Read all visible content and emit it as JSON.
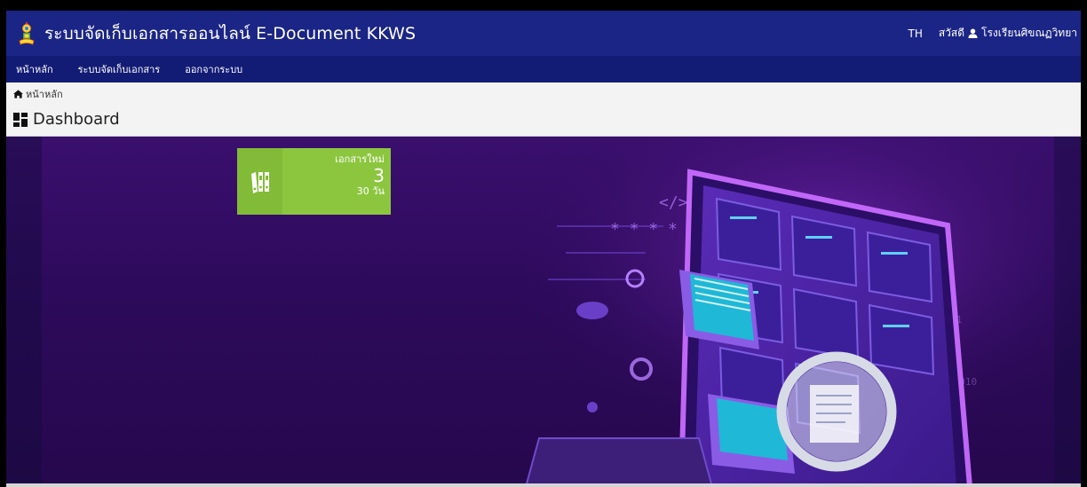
{
  "header": {
    "title": "ระบบจัดเก็บเอกสารออนไลน์ E-Document KKWS",
    "lang": "TH",
    "greeting": "สวัสดี",
    "user": "โรงเรียนศิขณฏวิทยา"
  },
  "nav": {
    "items": [
      {
        "label": "หน้าหลัก"
      },
      {
        "label": "ระบบจัดเก็บเอกสาร"
      },
      {
        "label": "ออกจากระบบ"
      }
    ]
  },
  "breadcrumb": {
    "home": "หน้าหลัก"
  },
  "page": {
    "title": "Dashboard"
  },
  "tile": {
    "label": "เอกสารใหม่",
    "count": "3",
    "sub": "30 วัน",
    "color": "#8cc63f"
  },
  "icons": [
    "school-logo-icon",
    "user-icon",
    "home-icon",
    "dashboard-icon",
    "binders-icon"
  ],
  "colors": {
    "topbar": "#1b2585",
    "navbar": "#131c75",
    "background": "#2d0a5b"
  }
}
